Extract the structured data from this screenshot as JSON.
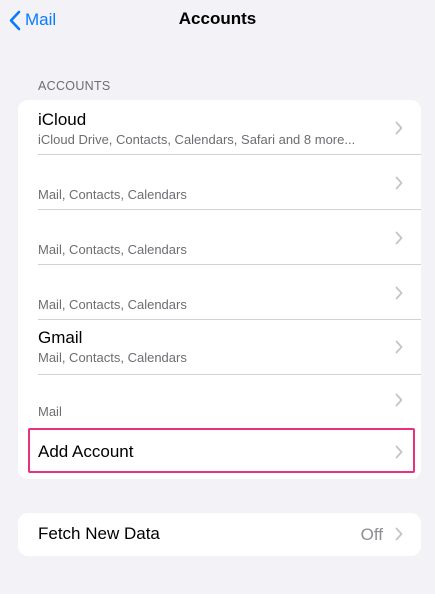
{
  "nav": {
    "back_label": "Mail",
    "title": "Accounts"
  },
  "accounts_section": {
    "header": "ACCOUNTS",
    "rows": [
      {
        "title": "iCloud",
        "subtitle": "iCloud Drive, Contacts, Calendars, Safari and 8 more..."
      },
      {
        "title": "",
        "subtitle": "Mail, Contacts, Calendars"
      },
      {
        "title": "",
        "subtitle": "Mail, Contacts, Calendars"
      },
      {
        "title": "",
        "subtitle": "Mail, Contacts, Calendars"
      },
      {
        "title": "Gmail",
        "subtitle": "Mail, Contacts, Calendars"
      },
      {
        "title": "",
        "subtitle": "Mail"
      }
    ],
    "add_account_label": "Add Account"
  },
  "fetch_section": {
    "label": "Fetch New Data",
    "value": "Off"
  },
  "colors": {
    "accent": "#0a7aff",
    "highlight": "#e8327f",
    "background": "#f2f2f7"
  },
  "icons": {
    "back": "chevron-left-icon",
    "disclosure": "chevron-right-icon"
  }
}
